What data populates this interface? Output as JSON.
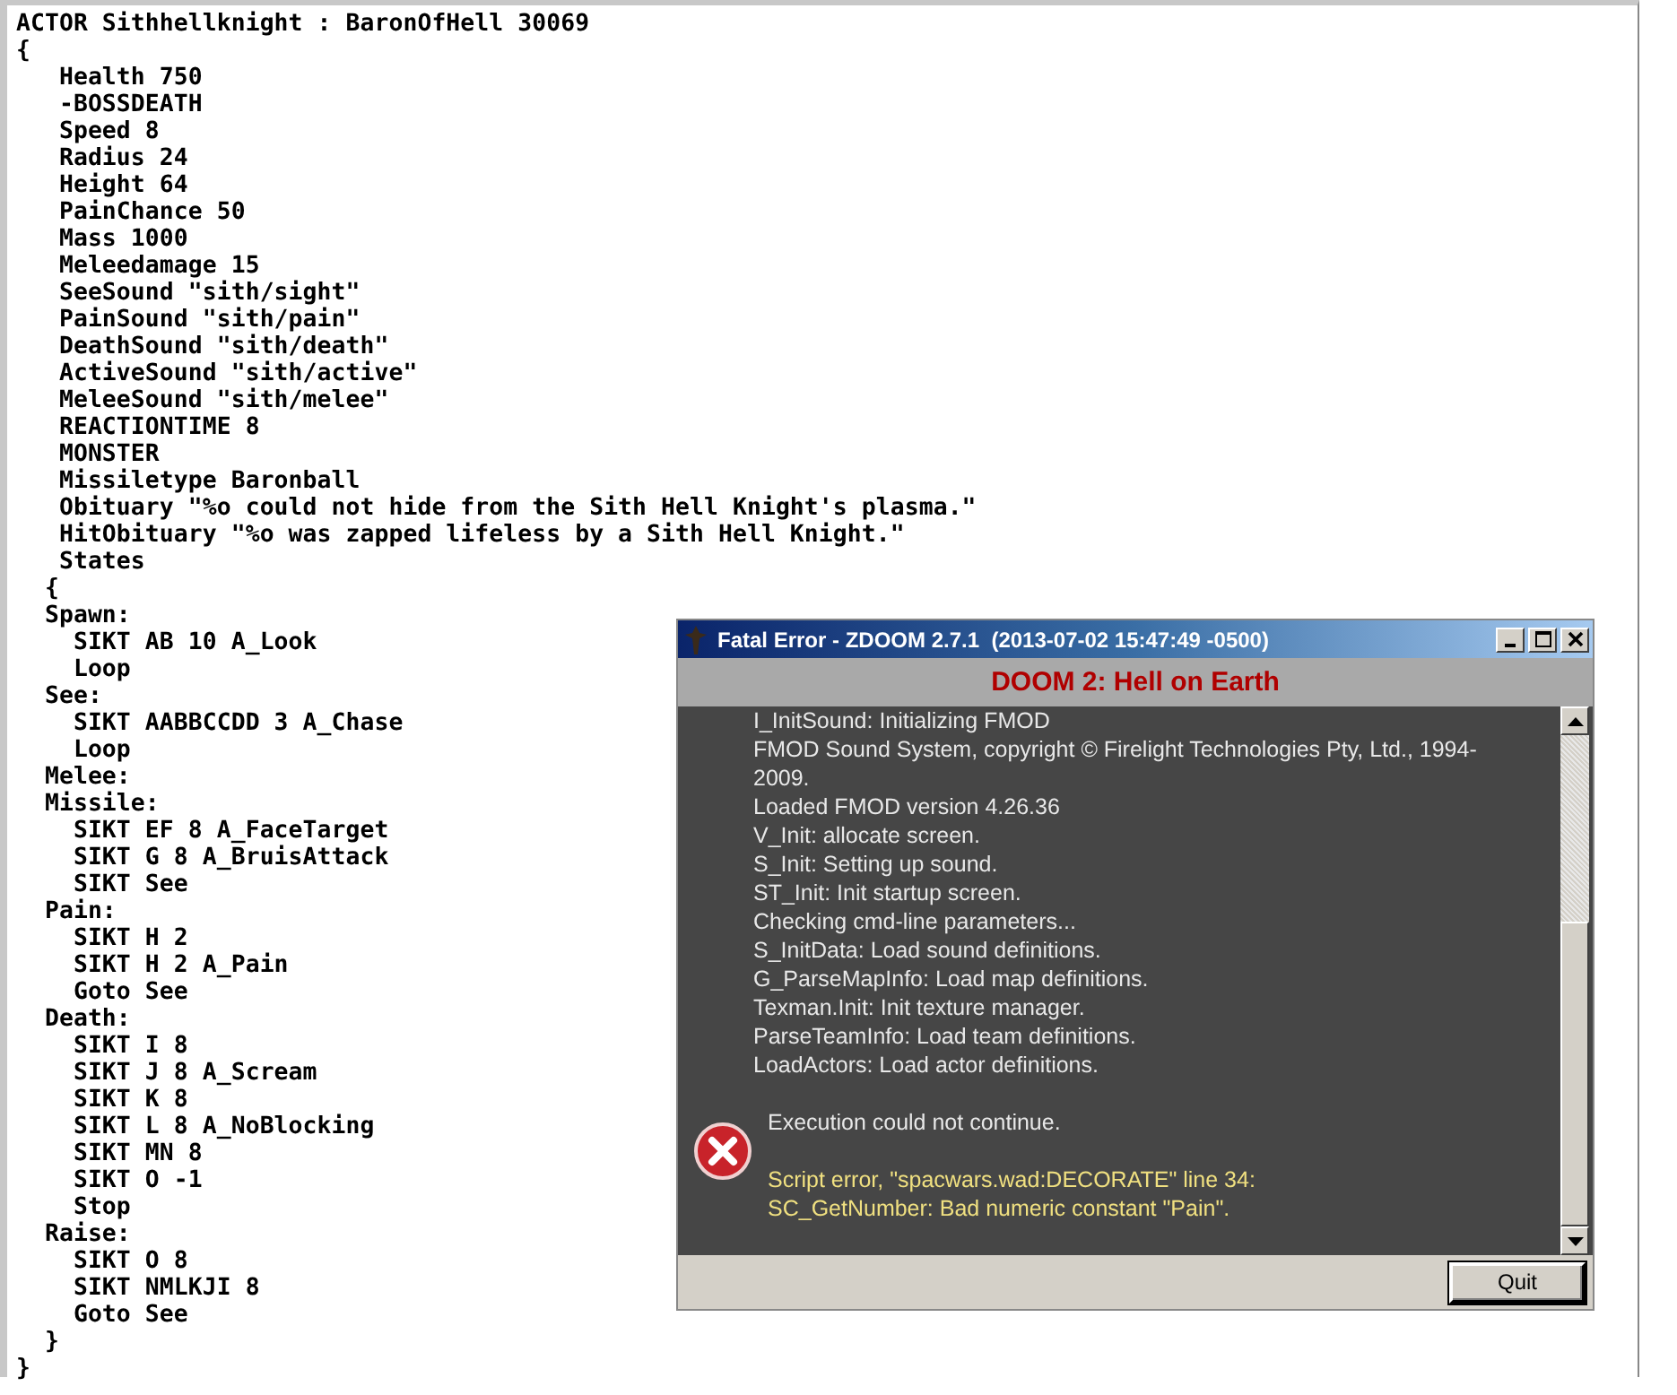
{
  "editor": {
    "lines": [
      "ACTOR Sithhellknight : BaronOfHell 30069",
      "{",
      "   Health 750",
      "   -BOSSDEATH",
      "   Speed 8",
      "   Radius 24",
      "   Height 64",
      "   PainChance 50",
      "   Mass 1000",
      "   Meleedamage 15",
      "   SeeSound \"sith/sight\"",
      "   PainSound \"sith/pain\"",
      "   DeathSound \"sith/death\"",
      "   ActiveSound \"sith/active\"",
      "   MeleeSound \"sith/melee\"",
      "   REACTIONTIME 8",
      "   MONSTER",
      "   Missiletype Baronball",
      "   Obituary \"%o could not hide from the Sith Hell Knight's plasma.\"",
      "   HitObituary \"%o was zapped lifeless by a Sith Hell Knight.\"",
      "   States",
      "  {",
      "  Spawn:",
      "    SIKT AB 10 A_Look",
      "    Loop",
      "  See:",
      "    SIKT AABBCCDD 3 A_Chase",
      "    Loop",
      "  Melee:",
      "  Missile:",
      "    SIKT EF 8 A_FaceTarget",
      "    SIKT G 8 A_BruisAttack",
      "    SIKT See",
      "  Pain:",
      "    SIKT H 2",
      "    SIKT H 2 A_Pain",
      "    Goto See",
      "  Death:",
      "    SIKT I 8",
      "    SIKT J 8 A_Scream",
      "    SIKT K 8",
      "    SIKT L 8 A_NoBlocking",
      "    SIKT MN 8",
      "    SIKT O -1",
      "    Stop",
      "  Raise:",
      "    SIKT O 8",
      "    SIKT NMLKJI 8",
      "    Goto See",
      "  }",
      "}"
    ]
  },
  "dialog": {
    "title": "Fatal Error - ZDOOM 2.7.1  (2013-07-02 15:47:49 -0500)",
    "header": "DOOM 2: Hell on Earth",
    "log": [
      "I_InitSound: Initializing FMOD",
      "FMOD Sound System, copyright © Firelight Technologies Pty, Ltd., 1994-2009.",
      "Loaded FMOD version 4.26.36",
      "V_Init: allocate screen.",
      "S_Init: Setting up sound.",
      "ST_Init: Init startup screen.",
      "Checking cmd-line parameters...",
      "S_InitData: Load sound definitions.",
      "G_ParseMapInfo: Load map definitions.",
      "Texman.Init: Init texture manager.",
      "ParseTeamInfo: Load team definitions.",
      "LoadActors: Load actor definitions."
    ],
    "error_title": "Execution could not continue.",
    "error_details": [
      "Script error, \"spacwars.wad:DECORATE\" line 34:",
      "SC_GetNumber: Bad numeric constant \"Pain\"."
    ],
    "buttons": [
      "Quit"
    ]
  }
}
